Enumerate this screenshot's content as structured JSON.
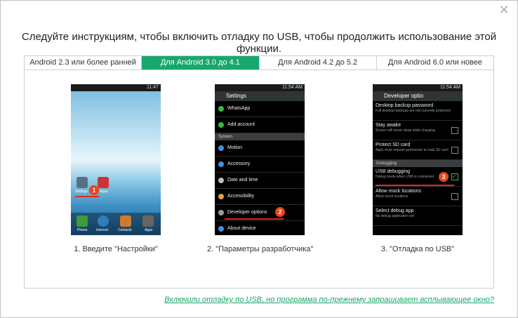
{
  "dialog": {
    "close_icon": "close-icon",
    "heading": "Следуйте инструкциям, чтобы включить отладку по USB, чтобы продолжить использование этой функции."
  },
  "tabs": [
    {
      "label": "Android 2.3 или более ранней",
      "active": false
    },
    {
      "label": "Для Android 3.0 до 4.1",
      "active": true
    },
    {
      "label": "Для Android 4.2 до 5.2",
      "active": false
    },
    {
      "label": "Для Android 6.0 или новее",
      "active": false
    }
  ],
  "steps": [
    {
      "caption": "1. Введите \"Настройки\"",
      "time": "11:47",
      "badge": "1",
      "apps": {
        "settings": "Settings",
        "apps": "Apps",
        "phone": "Phone",
        "internet": "Internet",
        "contacts": "Contacts",
        "apps2": "Apps"
      }
    },
    {
      "caption": "2. \"Параметры разработчика\"",
      "time": "11:54 AM",
      "badge": "2",
      "title": "Settings",
      "rows": [
        "WhatsApp",
        "Add account"
      ],
      "section": "System",
      "rows2": [
        "Motion",
        "Accessory",
        "Date and time",
        "Accessibility",
        "Developer options",
        "About device"
      ]
    },
    {
      "caption": "3. \"Отладка по USB\"",
      "time": "11:54 AM",
      "badge": "3",
      "title": "Developer optio",
      "items": [
        {
          "title": "Desktop backup password",
          "sub": "Full desktop backups are not currently protected"
        },
        {
          "title": "Stay awake",
          "sub": "Screen will never sleep while charging"
        },
        {
          "title": "Protect SD card",
          "sub": "Apps must request permission to read SD card"
        }
      ],
      "section": "Debugging",
      "items2": [
        {
          "title": "USB debugging",
          "sub": "Debug mode when USB is connected"
        },
        {
          "title": "Allow mock locations",
          "sub": "Allow mock locations"
        },
        {
          "title": "Select debug app",
          "sub": "No debug application set"
        }
      ]
    }
  ],
  "help_link": "Включили отладку по USB, но программа по-прежнему запрашивает всплывающее окно?",
  "colors": {
    "accent": "#17a86b",
    "badge": "#e8451e",
    "link": "#19a56a"
  }
}
